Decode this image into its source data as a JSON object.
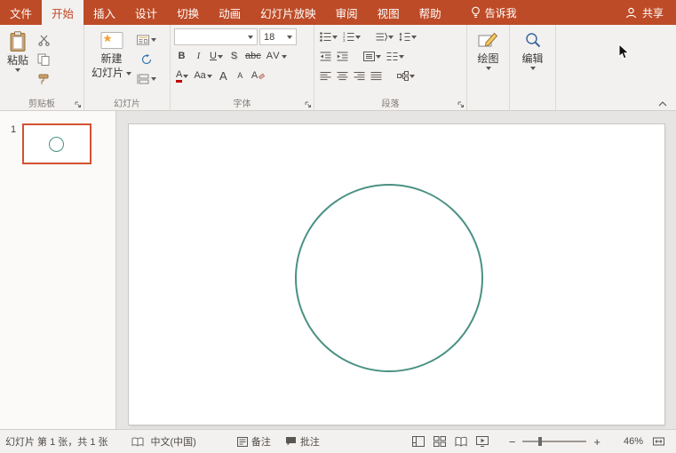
{
  "tabbar": {
    "tabs": [
      "文件",
      "开始",
      "插入",
      "设计",
      "切换",
      "动画",
      "幻灯片放映",
      "审阅",
      "视图",
      "帮助"
    ],
    "active_tab": "开始",
    "tell_me": "告诉我",
    "share": "共享"
  },
  "ribbon": {
    "clipboard": {
      "paste": "粘贴",
      "label": "剪贴板"
    },
    "slides": {
      "new_slide_top": "新建",
      "new_slide_bottom": "幻灯片",
      "label": "幻灯片"
    },
    "font": {
      "name_value": "",
      "size_value": "18",
      "buttons": {
        "bold": "B",
        "italic": "I",
        "underline": "U",
        "shadow": "S",
        "strikethrough": "abc",
        "spacing": "AV",
        "color": "A",
        "case": "Aa",
        "grow": "A",
        "shrink": "A",
        "clear": "A"
      },
      "label": "字体"
    },
    "paragraph": {
      "label": "段落"
    },
    "drawing": {
      "label": "绘图"
    },
    "editing": {
      "label": "编辑"
    }
  },
  "panel": {
    "slide_number": "1"
  },
  "statusbar": {
    "slide_info": "幻灯片 第 1 张，共 1 张",
    "language": "中文(中国)",
    "notes": "备注",
    "comments": "批注",
    "zoom_out": "−",
    "zoom_in": "+",
    "zoom_level": "46%"
  },
  "colors": {
    "accent": "#BE4B27",
    "circle_stroke": "#4A9183",
    "thumb_border": "#D35230"
  },
  "icons": {
    "lightbulb-icon": "bulb shape",
    "person-icon": "head+shoulders",
    "clipboard-icon": "clipboard+page",
    "scissors-icon": "crossed blades",
    "copy-icon": "two pages",
    "format-painter-icon": "brush",
    "new-slide-icon": "slide+star",
    "layout-icon": "slide layout",
    "reset-icon": "circular arrow",
    "section-icon": "bracket+slides",
    "bullet-list-icon": "dots+lines",
    "numbered-list-icon": "digits+lines",
    "indent-decrease-icon": "left arrow+lines",
    "indent-increase-icon": "right arrow+lines",
    "line-spacing-icon": "v-arrows+lines",
    "text-direction-icon": "lines+chevron",
    "align-left-icon": "lines",
    "align-center-icon": "lines",
    "align-right-icon": "lines",
    "justify-icon": "lines",
    "align-text-icon": "box+lines",
    "smartart-icon": "linked boxes",
    "drawing-icon": "canvas+pencil",
    "editing-icon": "magnifier",
    "dialog-launcher-icon": "corner arrow",
    "collapse-ribbon-icon": "chevron up",
    "proofing-icon": "open book",
    "notes-icon": "page+lines",
    "comments-icon": "speech bubble",
    "normal-view-icon": "panes",
    "slide-sorter-icon": "four squares",
    "reading-view-icon": "book",
    "slideshow-view-icon": "screen+play",
    "fit-window-icon": "frame+arrows",
    "mouse-cursor": "arrow pointer"
  }
}
